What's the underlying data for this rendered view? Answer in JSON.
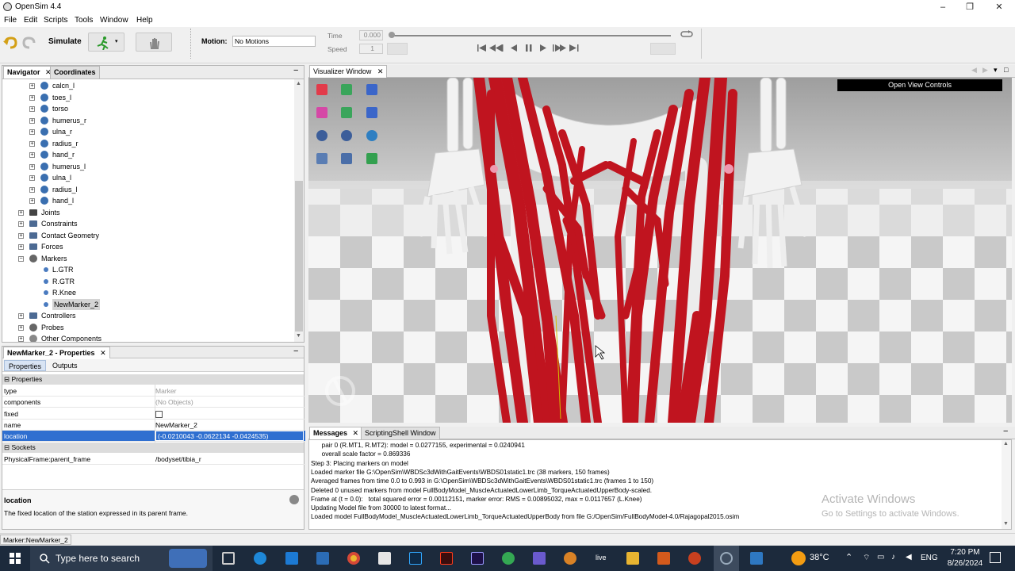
{
  "window": {
    "title": "OpenSim 4.4",
    "minimize": "–",
    "maximize": "❐",
    "close": "✕"
  },
  "menu": [
    "File",
    "Edit",
    "Scripts",
    "Tools",
    "Window",
    "Help"
  ],
  "toolbar": {
    "simulate_label": "Simulate",
    "motion_label": "Motion:",
    "motion_value": "No Motions",
    "time_label": "Time",
    "time_value": "0.000",
    "speed_label": "Speed",
    "speed_value": "1"
  },
  "navigator": {
    "tabs": [
      "Navigator",
      "Coordinates"
    ],
    "items": [
      {
        "label": "calcn_l",
        "level": 3,
        "icon": "body"
      },
      {
        "label": "toes_l",
        "level": 3,
        "icon": "body"
      },
      {
        "label": "torso",
        "level": 3,
        "icon": "body"
      },
      {
        "label": "humerus_r",
        "level": 3,
        "icon": "body"
      },
      {
        "label": "ulna_r",
        "level": 3,
        "icon": "body"
      },
      {
        "label": "radius_r",
        "level": 3,
        "icon": "body"
      },
      {
        "label": "hand_r",
        "level": 3,
        "icon": "body"
      },
      {
        "label": "humerus_l",
        "level": 3,
        "icon": "body"
      },
      {
        "label": "ulna_l",
        "level": 3,
        "icon": "body"
      },
      {
        "label": "radius_l",
        "level": 3,
        "icon": "body"
      },
      {
        "label": "hand_l",
        "level": 3,
        "icon": "body"
      },
      {
        "label": "Joints",
        "level": 2,
        "icon": "joint"
      },
      {
        "label": "Constraints",
        "level": 2,
        "icon": "group"
      },
      {
        "label": "Contact Geometry",
        "level": 2,
        "icon": "group"
      },
      {
        "label": "Forces",
        "level": 2,
        "icon": "group"
      },
      {
        "label": "Markers",
        "level": 2,
        "icon": "marker",
        "expanded": true
      },
      {
        "label": "L.GTR",
        "level": 3,
        "icon": "dot"
      },
      {
        "label": "R.GTR",
        "level": 3,
        "icon": "dot"
      },
      {
        "label": "R.Knee",
        "level": 3,
        "icon": "dot"
      },
      {
        "label": "NewMarker_2",
        "level": 3,
        "icon": "dot",
        "selected": true
      },
      {
        "label": "Controllers",
        "level": 2,
        "icon": "group"
      },
      {
        "label": "Probes",
        "level": 2,
        "icon": "probe"
      },
      {
        "label": "Other Components",
        "level": 2,
        "icon": "other"
      }
    ]
  },
  "properties": {
    "panel_title": "NewMarker_2 - Properties",
    "tabs": [
      "Properties",
      "Outputs"
    ],
    "section_properties": "Properties",
    "rows": [
      {
        "key": "type",
        "value": "Marker",
        "muted": true
      },
      {
        "key": "components",
        "value": "(No Objects)",
        "muted": true
      },
      {
        "key": "fixed",
        "value": "",
        "checkbox": true
      },
      {
        "key": "name",
        "value": "NewMarker_2"
      },
      {
        "key": "location",
        "value": "(-0.0210043 -0.0622134 -0.0424535)",
        "selected": true
      }
    ],
    "section_sockets": "Sockets",
    "socket_rows": [
      {
        "key": "PhysicalFrame:parent_frame",
        "value": "/bodyset/tibia_r"
      }
    ],
    "desc_title": "location",
    "desc_text": "The fixed location of the station expressed in its parent frame."
  },
  "visualizer": {
    "tab": "Visualizer Window",
    "open_view_controls": "Open View Controls"
  },
  "messages": {
    "tabs": [
      "Messages",
      "ScriptingShell Window"
    ],
    "lines": [
      "      pair 0 (R.MT1, R.MT2): model = 0.0277155, experimental = 0.0240941",
      "      overall scale factor = 0.869336",
      "Step 3: Placing markers on model",
      "Loaded marker file G:\\OpenSim\\WBDSc3dWithGaitEvents\\WBDS01static1.trc (38 markers, 150 frames)",
      "Averaged frames from time 0.0 to 0.993 in G:\\OpenSim\\WBDSc3dWithGaitEvents\\WBDS01static1.trc (frames 1 to 150)",
      "Deleted 0 unused markers from model FullBodyModel_MuscleActuatedLowerLimb_TorqueActuatedUpperBody-scaled.",
      "Frame at (t = 0.0):   total squared error = 0.00112151, marker error: RMS = 0.00895032, max = 0.0117657 (L.Knee)",
      "Updating Model file from 30000 to latest format...",
      "Loaded model FullBodyModel_MuscleActuatedLowerLimb_TorqueActuatedUpperBody from file G:/OpenSim/FullBodyModel-4.0/Rajagopal2015.osim"
    ],
    "watermark_title": "Activate Windows",
    "watermark_sub": "Go to Settings to activate Windows."
  },
  "statusbar": {
    "text": "Marker:NewMarker_2"
  },
  "taskbar": {
    "search_placeholder": "Type here to search",
    "temperature": "38°C",
    "language": "ENG",
    "time": "7:20 PM",
    "date": "8/26/2024",
    "live_label": "live"
  }
}
